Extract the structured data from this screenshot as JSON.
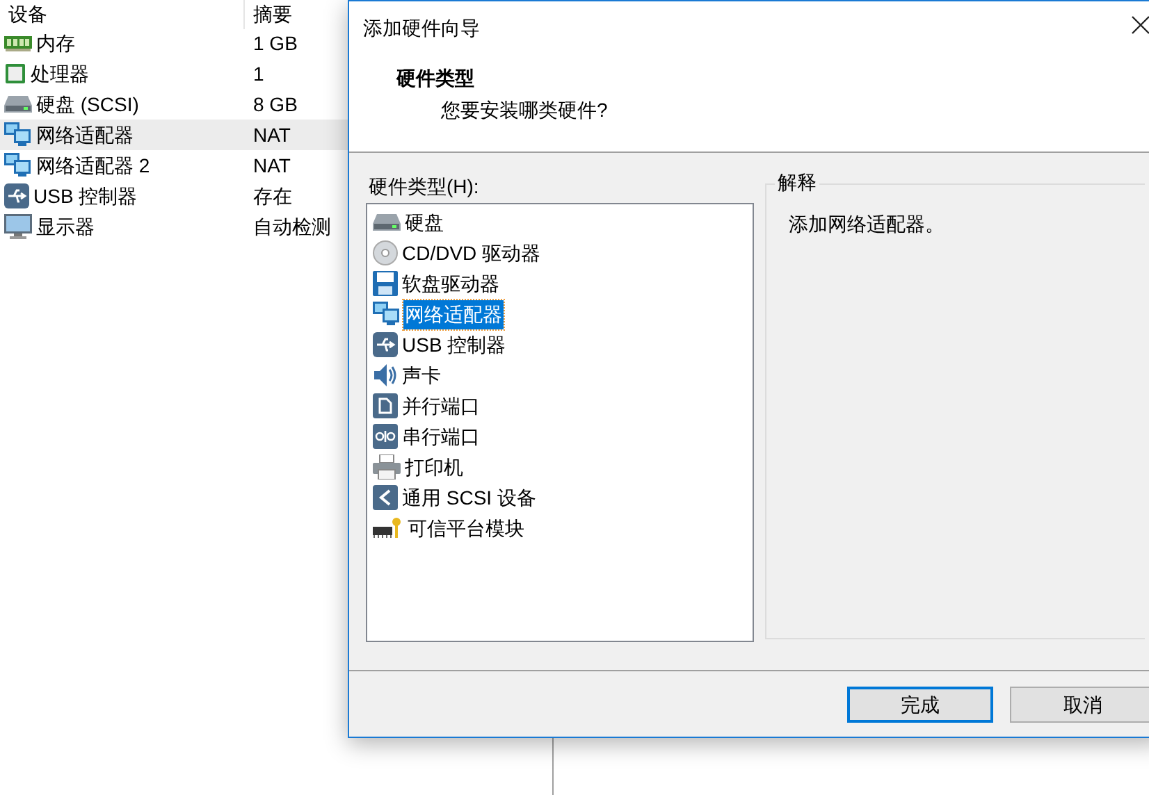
{
  "devices": {
    "columns": [
      "设备",
      "摘要"
    ],
    "rows": [
      {
        "name": "内存",
        "summary": "1 GB",
        "selected": false
      },
      {
        "name": "处理器",
        "summary": "1",
        "selected": false
      },
      {
        "name": "硬盘 (SCSI)",
        "summary": "8 GB",
        "selected": false
      },
      {
        "name": "网络适配器",
        "summary": "NAT",
        "selected": true
      },
      {
        "name": "网络适配器 2",
        "summary": "NAT",
        "selected": false
      },
      {
        "name": "USB 控制器",
        "summary": "存在",
        "selected": false
      },
      {
        "name": "显示器",
        "summary": "自动检测",
        "selected": false
      }
    ]
  },
  "dialog": {
    "title": "添加硬件向导",
    "heading": "硬件类型",
    "subheading": "您要安装哪类硬件?",
    "list_label": "硬件类型(H):",
    "hardware_types": [
      {
        "label": "硬盘",
        "selected": false
      },
      {
        "label": "CD/DVD 驱动器",
        "selected": false
      },
      {
        "label": "软盘驱动器",
        "selected": false
      },
      {
        "label": "网络适配器",
        "selected": true
      },
      {
        "label": "USB 控制器",
        "selected": false
      },
      {
        "label": "声卡",
        "selected": false
      },
      {
        "label": "并行端口",
        "selected": false
      },
      {
        "label": "串行端口",
        "selected": false
      },
      {
        "label": "打印机",
        "selected": false
      },
      {
        "label": "通用 SCSI 设备",
        "selected": false
      },
      {
        "label": "可信平台模块",
        "selected": false
      }
    ],
    "explanation_title": "解释",
    "explanation": "添加网络适配器。",
    "buttons": [
      {
        "label": "完成",
        "default": true
      },
      {
        "label": "取消",
        "default": false
      }
    ]
  }
}
